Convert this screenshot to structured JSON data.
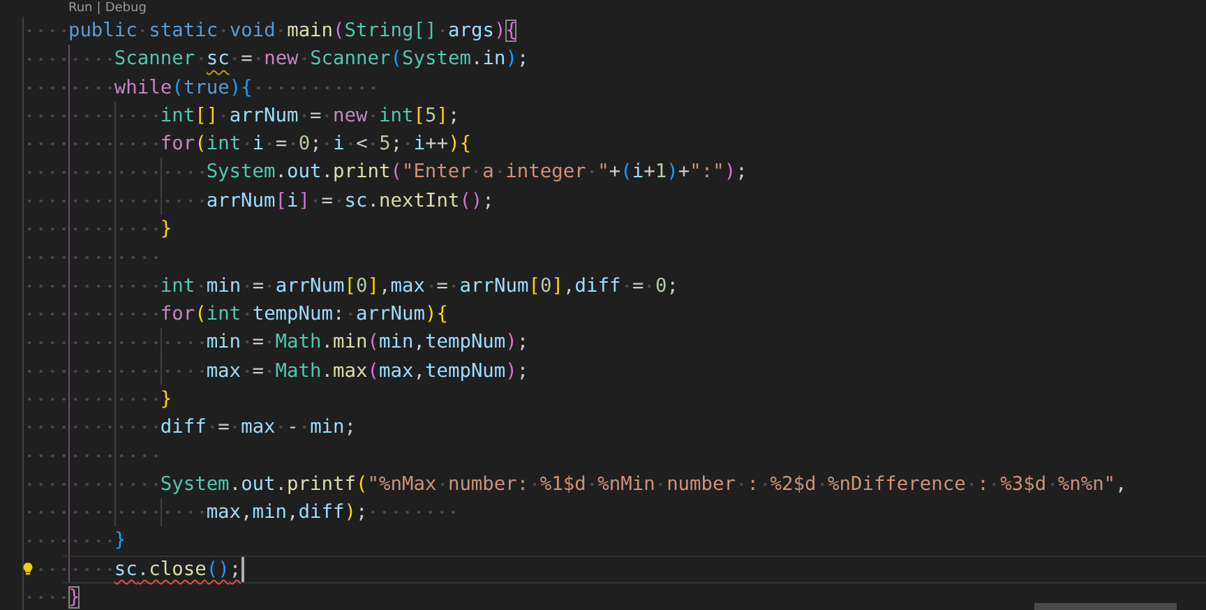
{
  "codelens": {
    "links": [
      {
        "text": "Run"
      },
      {
        "text": "Debug"
      }
    ],
    "separator": "|"
  },
  "lines": [
    {
      "current": false,
      "lightbulb": false,
      "tokens": [
        {
          "kind": "kw",
          "text": "    public static void "
        },
        {
          "kind": "fn",
          "text": "main"
        },
        {
          "kind": "b2",
          "text": "("
        },
        {
          "kind": "type",
          "text": "String[] "
        },
        {
          "kind": "var",
          "text": "args"
        },
        {
          "kind": "b2",
          "text": ")"
        },
        {
          "kind": "b2",
          "text": "{",
          "matched": true
        }
      ]
    },
    {
      "current": false,
      "lightbulb": false,
      "tokens": [
        {
          "kind": "type",
          "text": "        Scanner "
        },
        {
          "kind": "var",
          "text": "sc",
          "warning": true
        },
        {
          "kind": "op",
          "text": " = "
        },
        {
          "kind": "ctl",
          "text": "new "
        },
        {
          "kind": "type",
          "text": "Scanner"
        },
        {
          "kind": "b3",
          "text": "("
        },
        {
          "kind": "type",
          "text": "System"
        },
        {
          "kind": "op",
          "text": "."
        },
        {
          "kind": "var",
          "text": "in"
        },
        {
          "kind": "b3",
          "text": ")"
        },
        {
          "kind": "op",
          "text": ";"
        }
      ]
    },
    {
      "current": false,
      "lightbulb": false,
      "tokens": [
        {
          "kind": "ctl",
          "text": "        while"
        },
        {
          "kind": "b3",
          "text": "("
        },
        {
          "kind": "kw",
          "text": "true"
        },
        {
          "kind": "b3",
          "text": ")"
        },
        {
          "kind": "b3",
          "text": "{           "
        }
      ]
    },
    {
      "current": false,
      "lightbulb": false,
      "tokens": [
        {
          "kind": "type",
          "text": "            int"
        },
        {
          "kind": "b1",
          "text": "[]"
        },
        {
          "kind": "var",
          "text": " arrNum"
        },
        {
          "kind": "op",
          "text": " = "
        },
        {
          "kind": "ctl",
          "text": "new "
        },
        {
          "kind": "type",
          "text": "int"
        },
        {
          "kind": "b1",
          "text": "["
        },
        {
          "kind": "num",
          "text": "5"
        },
        {
          "kind": "b1",
          "text": "]"
        },
        {
          "kind": "op",
          "text": ";"
        }
      ]
    },
    {
      "current": false,
      "lightbulb": false,
      "tokens": [
        {
          "kind": "ctl",
          "text": "            for"
        },
        {
          "kind": "b1",
          "text": "("
        },
        {
          "kind": "type",
          "text": "int "
        },
        {
          "kind": "var",
          "text": "i"
        },
        {
          "kind": "op",
          "text": " = "
        },
        {
          "kind": "num",
          "text": "0"
        },
        {
          "kind": "op",
          "text": "; "
        },
        {
          "kind": "var",
          "text": "i"
        },
        {
          "kind": "op",
          "text": " < "
        },
        {
          "kind": "num",
          "text": "5"
        },
        {
          "kind": "op",
          "text": "; "
        },
        {
          "kind": "var",
          "text": "i"
        },
        {
          "kind": "op",
          "text": "++"
        },
        {
          "kind": "b1",
          "text": ")"
        },
        {
          "kind": "b1",
          "text": "{"
        }
      ]
    },
    {
      "current": false,
      "lightbulb": false,
      "tokens": [
        {
          "kind": "type",
          "text": "                System"
        },
        {
          "kind": "op",
          "text": "."
        },
        {
          "kind": "var",
          "text": "out"
        },
        {
          "kind": "op",
          "text": "."
        },
        {
          "kind": "fn",
          "text": "print"
        },
        {
          "kind": "b2",
          "text": "("
        },
        {
          "kind": "str",
          "text": "\"Enter a integer \""
        },
        {
          "kind": "op",
          "text": "+"
        },
        {
          "kind": "b3",
          "text": "("
        },
        {
          "kind": "var",
          "text": "i"
        },
        {
          "kind": "op",
          "text": "+"
        },
        {
          "kind": "num",
          "text": "1"
        },
        {
          "kind": "b3",
          "text": ")"
        },
        {
          "kind": "op",
          "text": "+"
        },
        {
          "kind": "str",
          "text": "\":\""
        },
        {
          "kind": "b2",
          "text": ")"
        },
        {
          "kind": "op",
          "text": ";"
        }
      ]
    },
    {
      "current": false,
      "lightbulb": false,
      "tokens": [
        {
          "kind": "var",
          "text": "                arrNum"
        },
        {
          "kind": "b2",
          "text": "["
        },
        {
          "kind": "var",
          "text": "i"
        },
        {
          "kind": "b2",
          "text": "]"
        },
        {
          "kind": "op",
          "text": " = "
        },
        {
          "kind": "var",
          "text": "sc"
        },
        {
          "kind": "op",
          "text": "."
        },
        {
          "kind": "fn",
          "text": "nextInt"
        },
        {
          "kind": "b2",
          "text": "()"
        },
        {
          "kind": "op",
          "text": ";"
        }
      ]
    },
    {
      "current": false,
      "lightbulb": false,
      "tokens": [
        {
          "kind": "b1",
          "text": "            }"
        }
      ]
    },
    {
      "current": false,
      "lightbulb": false
    },
    {
      "current": false,
      "lightbulb": false,
      "tokens": [
        {
          "kind": "type",
          "text": "            int "
        },
        {
          "kind": "var",
          "text": "min"
        },
        {
          "kind": "op",
          "text": " = "
        },
        {
          "kind": "var",
          "text": "arrNum"
        },
        {
          "kind": "b1",
          "text": "["
        },
        {
          "kind": "num",
          "text": "0"
        },
        {
          "kind": "b1",
          "text": "]"
        },
        {
          "kind": "op",
          "text": ","
        },
        {
          "kind": "var",
          "text": "max"
        },
        {
          "kind": "op",
          "text": " = "
        },
        {
          "kind": "var",
          "text": "arrNum"
        },
        {
          "kind": "b1",
          "text": "["
        },
        {
          "kind": "num",
          "text": "0"
        },
        {
          "kind": "b1",
          "text": "]"
        },
        {
          "kind": "op",
          "text": ","
        },
        {
          "kind": "var",
          "text": "diff"
        },
        {
          "kind": "op",
          "text": " = "
        },
        {
          "kind": "num",
          "text": "0"
        },
        {
          "kind": "op",
          "text": ";"
        }
      ]
    },
    {
      "current": false,
      "lightbulb": false,
      "tokens": [
        {
          "kind": "ctl",
          "text": "            for"
        },
        {
          "kind": "b1",
          "text": "("
        },
        {
          "kind": "type",
          "text": "int "
        },
        {
          "kind": "var",
          "text": "tempNum"
        },
        {
          "kind": "op",
          "text": ": "
        },
        {
          "kind": "var",
          "text": "arrNum"
        },
        {
          "kind": "b1",
          "text": ")"
        },
        {
          "kind": "b1",
          "text": "{"
        }
      ]
    },
    {
      "current": false,
      "lightbulb": false,
      "tokens": [
        {
          "kind": "var",
          "text": "                min"
        },
        {
          "kind": "op",
          "text": " = "
        },
        {
          "kind": "type",
          "text": "Math"
        },
        {
          "kind": "op",
          "text": "."
        },
        {
          "kind": "fn",
          "text": "min"
        },
        {
          "kind": "b2",
          "text": "("
        },
        {
          "kind": "var",
          "text": "min"
        },
        {
          "kind": "op",
          "text": ","
        },
        {
          "kind": "var",
          "text": "tempNum"
        },
        {
          "kind": "b2",
          "text": ")"
        },
        {
          "kind": "op",
          "text": ";"
        }
      ]
    },
    {
      "current": false,
      "lightbulb": false,
      "tokens": [
        {
          "kind": "var",
          "text": "                max"
        },
        {
          "kind": "op",
          "text": " = "
        },
        {
          "kind": "type",
          "text": "Math"
        },
        {
          "kind": "op",
          "text": "."
        },
        {
          "kind": "fn",
          "text": "max"
        },
        {
          "kind": "b2",
          "text": "("
        },
        {
          "kind": "var",
          "text": "max"
        },
        {
          "kind": "op",
          "text": ","
        },
        {
          "kind": "var",
          "text": "tempNum"
        },
        {
          "kind": "b2",
          "text": ")"
        },
        {
          "kind": "op",
          "text": ";"
        }
      ]
    },
    {
      "current": false,
      "lightbulb": false,
      "tokens": [
        {
          "kind": "b1",
          "text": "            }"
        }
      ]
    },
    {
      "current": false,
      "lightbulb": false,
      "tokens": [
        {
          "kind": "var",
          "text": "            diff"
        },
        {
          "kind": "op",
          "text": " = "
        },
        {
          "kind": "var",
          "text": "max"
        },
        {
          "kind": "op",
          "text": " - "
        },
        {
          "kind": "var",
          "text": "min"
        },
        {
          "kind": "op",
          "text": ";"
        }
      ]
    },
    {
      "current": false,
      "lightbulb": false
    },
    {
      "current": false,
      "lightbulb": false,
      "tokens": [
        {
          "kind": "type",
          "text": "            System"
        },
        {
          "kind": "op",
          "text": "."
        },
        {
          "kind": "var",
          "text": "out"
        },
        {
          "kind": "op",
          "text": "."
        },
        {
          "kind": "fn",
          "text": "printf"
        },
        {
          "kind": "b1",
          "text": "("
        },
        {
          "kind": "str",
          "text": "\"%nMax number: %1$d %nMin number : %2$d %nDifference : %3$d %n%n\""
        },
        {
          "kind": "op",
          "text": ","
        }
      ]
    },
    {
      "current": false,
      "lightbulb": false,
      "tokens": [
        {
          "kind": "var",
          "text": "                max"
        },
        {
          "kind": "op",
          "text": ","
        },
        {
          "kind": "var",
          "text": "min"
        },
        {
          "kind": "op",
          "text": ","
        },
        {
          "kind": "var",
          "text": "diff"
        },
        {
          "kind": "b1",
          "text": ")"
        },
        {
          "kind": "op",
          "text": ";        "
        }
      ]
    },
    {
      "current": false,
      "lightbulb": false,
      "tokens": [
        {
          "kind": "b3",
          "text": "        }"
        }
      ]
    },
    {
      "current": true,
      "lightbulb": true,
      "tokens": [
        {
          "kind": "var",
          "text": "        sc",
          "error": true
        },
        {
          "kind": "op",
          "text": ".",
          "error": true
        },
        {
          "kind": "fn",
          "text": "close",
          "error": true
        },
        {
          "kind": "b3",
          "text": "()",
          "error": true
        },
        {
          "kind": "op",
          "text": ";",
          "error": true
        }
      ]
    },
    {
      "current": false,
      "lightbulb": false,
      "tokens": [
        {
          "kind": "b2",
          "text": "    }",
          "matched": true
        }
      ]
    }
  ]
}
